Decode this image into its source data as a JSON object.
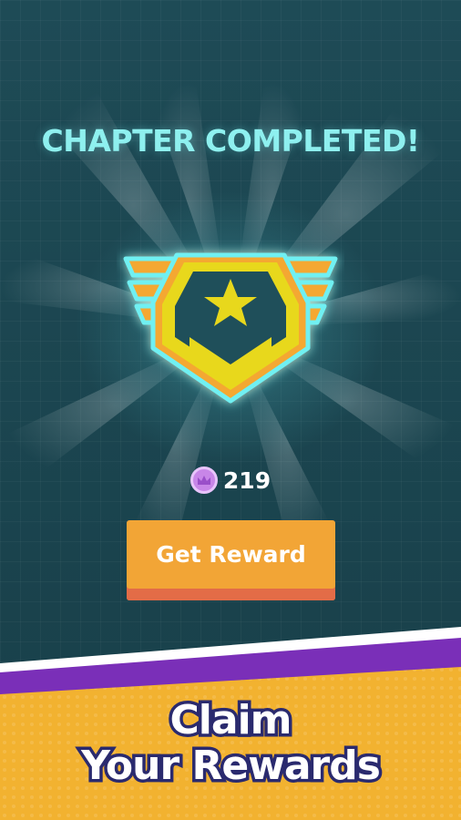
{
  "chapter_screen": {
    "title": "CHAPTER COMPLETED!",
    "currency": {
      "icon": "crown-coin-icon",
      "value": "219",
      "color": "#c886e8"
    },
    "get_reward_button_label": "Get Reward",
    "badge_icon": "star-rank-badge-icon"
  },
  "promo_banner": {
    "line1": "Claim",
    "line2": "Your Rewards"
  },
  "colors": {
    "background": "#1b4752",
    "title": "#8ef0ef",
    "button": "#f2a536",
    "button_shadow": "#e36c47",
    "banner_yellow": "#f2b230",
    "banner_purple": "#7a2fb8",
    "banner_text_outline": "#2a2a6e"
  }
}
